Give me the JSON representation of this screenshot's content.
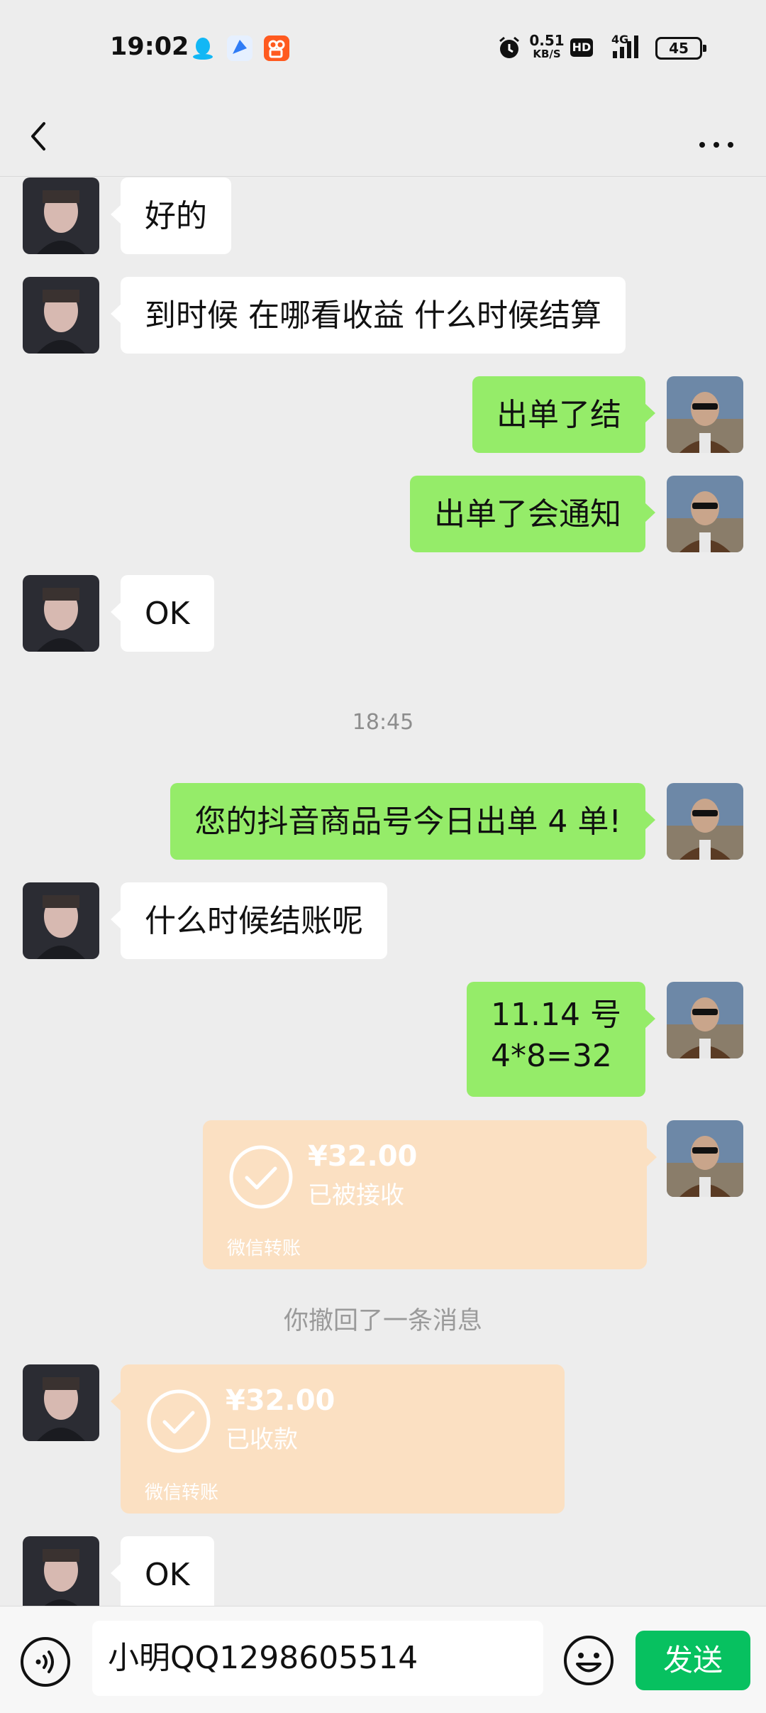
{
  "status_bar": {
    "time": "19:02",
    "net_speed_value": "0.51",
    "net_speed_unit": "KB/S",
    "hd_label": "HD",
    "network_label": "4G",
    "battery": "45",
    "app_icons": [
      "qq-icon",
      "blue-app-icon",
      "kuaishou-icon"
    ]
  },
  "header": {
    "back_icon": "chevron-left-icon",
    "more_icon": "more-dots-icon"
  },
  "messages": [
    {
      "side": "left",
      "text": "好的"
    },
    {
      "side": "left",
      "text": "到时候 在哪看收益 什么时候结算"
    },
    {
      "side": "right",
      "text": "出单了结"
    },
    {
      "side": "right",
      "text": "出单了会通知"
    },
    {
      "side": "left",
      "text": "OK"
    },
    {
      "side": "right",
      "text": "您的抖音商品号今日出单 4 单!"
    },
    {
      "side": "left",
      "text": "什么时候结账呢"
    },
    {
      "side": "right",
      "text_line1": "11.14 号",
      "text_line2": "4*8=32"
    },
    {
      "side": "left",
      "text": "OK"
    }
  ],
  "timestamp": "18:45",
  "transfers": [
    {
      "side": "right",
      "amount": "¥32.00",
      "status": "已被接收",
      "footer": "微信转账"
    },
    {
      "side": "left",
      "amount": "¥32.00",
      "status": "已收款",
      "footer": "微信转账"
    }
  ],
  "recall_notice": "你撤回了一条消息",
  "input_bar": {
    "text": "小明QQ1298605514",
    "send_label": "发送"
  },
  "colors": {
    "background": "#ededed",
    "bubble_right": "#95ec69",
    "bubble_left": "#ffffff",
    "transfer": "#fbe0c2",
    "send_button": "#07c160"
  }
}
